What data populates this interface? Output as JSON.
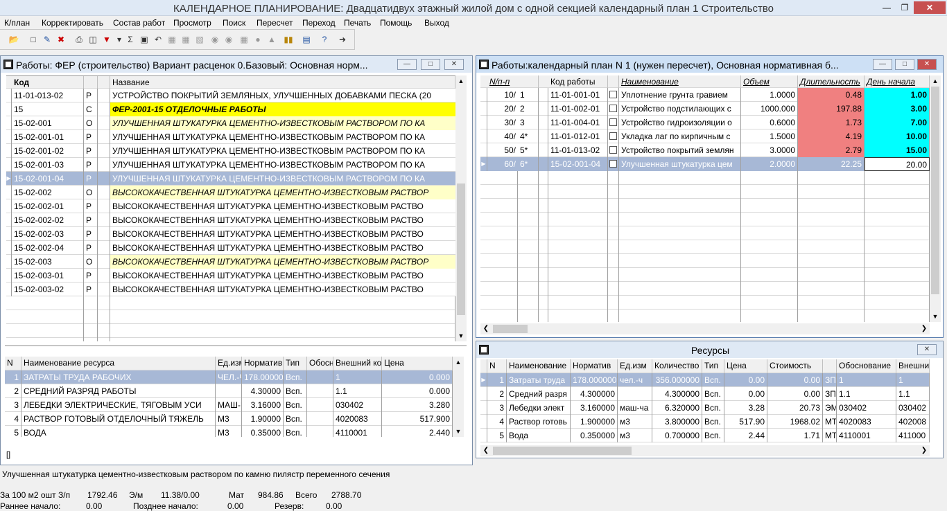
{
  "app": {
    "title": "КАЛЕНДАРНОЕ ПЛАНИРОВАНИЕ: Двадцатидвух этажный жилой дом с одной секцией календарный план 1 Строительство"
  },
  "menu": [
    "К/план",
    "Корректировать",
    "Состав работ",
    "Просмотр",
    "Поиск",
    "Пересчет",
    "Переход",
    "Печать",
    "Помощь",
    "Выход"
  ],
  "toolbar_icons": [
    "open-icon",
    "new-icon",
    "edit-icon",
    "delete-icon",
    "print-icon",
    "printer-icon",
    "copy-icon",
    "filter-icon",
    "sum-icon",
    "save-icon",
    "undo-icon",
    "grid-icon",
    "calc-icon",
    "binoculars-icon",
    "find-icon",
    "table-icon",
    "stop-icon",
    "tree-icon",
    "book-icon",
    "chart-icon",
    "help-icon",
    "exit-icon"
  ],
  "left_window": {
    "title": "Работы: ФЕР (строительство) Вариант расценок 0.Базовый: Основная норм...",
    "columns": [
      "Код",
      "",
      "",
      "Название"
    ],
    "rows": [
      {
        "code": "11-01-013-02",
        "type": "Р",
        "name": "УСТРОЙСТВО ПОКРЫТИЙ ЗЕМЛЯНЫХ, УЛУЧШЕННЫХ ДОБАВКАМИ ПЕСКА (20",
        "style": "normal"
      },
      {
        "code": "15",
        "type": "С",
        "name": "ФЕР-2001-15 ОТДЕЛОЧНЫЕ РАБОТЫ",
        "style": "section"
      },
      {
        "code": "15-02-001",
        "type": "О",
        "name": "УЛУЧШЕННАЯ ШТУКАТУРКА ЦЕМЕНТНО-ИЗВЕСТКОВЫМ РАСТВОРОМ ПО КА",
        "style": "group"
      },
      {
        "code": "15-02-001-01",
        "type": "Р",
        "name": "УЛУЧШЕННАЯ ШТУКАТУРКА ЦЕМЕНТНО-ИЗВЕСТКОВЫМ РАСТВОРОМ ПО КА",
        "style": "normal"
      },
      {
        "code": "15-02-001-02",
        "type": "Р",
        "name": "УЛУЧШЕННАЯ ШТУКАТУРКА ЦЕМЕНТНО-ИЗВЕСТКОВЫМ РАСТВОРОМ ПО КА",
        "style": "normal"
      },
      {
        "code": "15-02-001-03",
        "type": "Р",
        "name": "УЛУЧШЕННАЯ ШТУКАТУРКА ЦЕМЕНТНО-ИЗВЕСТКОВЫМ РАСТВОРОМ ПО КА",
        "style": "normal"
      },
      {
        "code": "15-02-001-04",
        "type": "Р",
        "name": "УЛУЧШЕННАЯ ШТУКАТУРКА ЦЕМЕНТНО-ИЗВЕСТКОВЫМ РАСТВОРОМ ПО КА",
        "style": "selected"
      },
      {
        "code": "15-02-002",
        "type": "О",
        "name": "ВЫСОКОКАЧЕСТВЕННАЯ ШТУКАТУРКА ЦЕМЕНТНО-ИЗВЕСТКОВЫМ РАСТВОР",
        "style": "group"
      },
      {
        "code": "15-02-002-01",
        "type": "Р",
        "name": "ВЫСОКОКАЧЕСТВЕННАЯ ШТУКАТУРКА ЦЕМЕНТНО-ИЗВЕСТКОВЫМ РАСТВО",
        "style": "normal"
      },
      {
        "code": "15-02-002-02",
        "type": "Р",
        "name": "ВЫСОКОКАЧЕСТВЕННАЯ ШТУКАТУРКА ЦЕМЕНТНО-ИЗВЕСТКОВЫМ РАСТВО",
        "style": "normal"
      },
      {
        "code": "15-02-002-03",
        "type": "Р",
        "name": "ВЫСОКОКАЧЕСТВЕННАЯ ШТУКАТУРКА ЦЕМЕНТНО-ИЗВЕСТКОВЫМ РАСТВО",
        "style": "normal"
      },
      {
        "code": "15-02-002-04",
        "type": "Р",
        "name": "ВЫСОКОКАЧЕСТВЕННАЯ ШТУКАТУРКА ЦЕМЕНТНО-ИЗВЕСТКОВЫМ РАСТВО",
        "style": "normal"
      },
      {
        "code": "15-02-003",
        "type": "О",
        "name": "ВЫСОКОКАЧЕСТВЕННАЯ ШТУКАТУРКА ЦЕМЕНТНО-ИЗВЕСТКОВЫМ РАСТВОР",
        "style": "group"
      },
      {
        "code": "15-02-003-01",
        "type": "Р",
        "name": "ВЫСОКОКАЧЕСТВЕННАЯ ШТУКАТУРКА ЦЕМЕНТНО-ИЗВЕСТКОВЫМ РАСТВО",
        "style": "normal"
      },
      {
        "code": "15-02-003-02",
        "type": "Р",
        "name": "ВЫСОКОКАЧЕСТВЕННАЯ ШТУКАТУРКА ЦЕМЕНТНО-ИЗВЕСТКОВЫМ РАСТВО",
        "style": "normal"
      }
    ],
    "res_columns": [
      "N",
      "Наименование ресурса",
      "Ед.изм",
      "Норматив",
      "Тип",
      "Обосн.",
      "Внешний ко",
      "Цена"
    ],
    "res_rows": [
      [
        "1",
        "ЗАТРАТЫ ТРУДА РАБОЧИХ",
        "ЧЕЛ.-Ч",
        "178.00000",
        "Всп.",
        "",
        "1",
        "0.000"
      ],
      [
        "2",
        "СРЕДНИЙ РАЗРЯД РАБОТЫ",
        "",
        "4.30000",
        "Всп.",
        "",
        "1.1",
        "0.000"
      ],
      [
        "3",
        "ЛЕБЕДКИ ЭЛЕКТРИЧЕСКИЕ, ТЯГОВЫМ УСИ",
        "МАШ-Ч",
        "3.16000",
        "Всп.",
        "",
        "030402",
        "3.280"
      ],
      [
        "4",
        "РАСТВОР ГОТОВЫЙ ОТДЕЛОЧНЫЙ ТЯЖЕЛЬ",
        "М3",
        "1.90000",
        "Всп.",
        "",
        "4020083",
        "517.900"
      ],
      [
        "5",
        "ВОДА",
        "М3",
        "0.35000",
        "Всп.",
        "",
        "4110001",
        "2.440"
      ]
    ]
  },
  "right_window": {
    "title": "Работы:календарный план  N 1 (нужен пересчет), Основная нормативная б...",
    "columns": [
      "N/п-п",
      "",
      "Код работы",
      "",
      "Наименование",
      "Объем",
      "Длительность",
      "День начала"
    ],
    "rows": [
      {
        "pos": "10/",
        "num": "1",
        "code": "11-01-001-01",
        "name": "Уплотнение грунта гравием",
        "volume": "1.0000",
        "duration": "0.48",
        "start": "1.00"
      },
      {
        "pos": "20/",
        "num": "2",
        "code": "11-01-002-01",
        "name": "Устройство подстилающих с",
        "volume": "1000.000",
        "duration": "197.88",
        "start": "3.00"
      },
      {
        "pos": "30/",
        "num": "3",
        "code": "11-01-004-01",
        "name": "Устройство гидроизоляции о",
        "volume": "0.6000",
        "duration": "1.73",
        "start": "7.00"
      },
      {
        "pos": "40/",
        "num": "4*",
        "code": "11-01-012-01",
        "name": "Укладка лаг по кирпичным с",
        "volume": "1.5000",
        "duration": "4.19",
        "start": "10.00"
      },
      {
        "pos": "50/",
        "num": "5*",
        "code": "11-01-013-02",
        "name": "Устройство покрытий землян",
        "volume": "3.0000",
        "duration": "2.79",
        "start": "15.00"
      },
      {
        "pos": "60/",
        "num": "6*",
        "code": "15-02-001-04",
        "name": "Улучшенная штукатурка цем",
        "volume": "2.0000",
        "duration": "22.25",
        "start": "20.00"
      }
    ]
  },
  "resources_window": {
    "title": "Ресурсы",
    "columns": [
      "N",
      "Наименование",
      "Норматив",
      "Ед.изм",
      "Количество",
      "Тип",
      "Цена",
      "Стоимость",
      "",
      "Обоснование",
      "Внешни"
    ],
    "rows": [
      [
        "1",
        "Затраты труда",
        "178.000000",
        "чел.-ч",
        "356.000000",
        "Всп.",
        "0.00",
        "0.00",
        "ЗП",
        "1",
        "1"
      ],
      [
        "2",
        "Средний разря",
        "4.300000",
        "",
        "4.300000",
        "Всп.",
        "0.00",
        "0.00",
        "ЗП",
        "1.1",
        "1.1"
      ],
      [
        "3",
        "Лебедки элект",
        "3.160000",
        "маш-ча",
        "6.320000",
        "Всп.",
        "3.28",
        "20.73",
        "ЭМ",
        "030402",
        "030402"
      ],
      [
        "4",
        "Раствор готовь",
        "1.900000",
        "м3",
        "3.800000",
        "Всп.",
        "517.90",
        "1968.02",
        "МТ",
        "4020083",
        "402008"
      ],
      [
        "5",
        "Вода",
        "0.350000",
        "м3",
        "0.700000",
        "Всп.",
        "2.44",
        "1.71",
        "МТ",
        "4110001",
        "411000"
      ]
    ]
  },
  "status": {
    "description": "Улучшенная штукатурка цементно-известковым раствором по камню пилястр переменного сечения",
    "line1": [
      {
        "label": "За 100 м2 ошт З/п",
        "value": "1792.46"
      },
      {
        "label": "Э/м",
        "value": "11.38/0.00"
      },
      {
        "label": "Мат",
        "value": "984.86"
      },
      {
        "label": "Всего",
        "value": "2788.70"
      }
    ],
    "line2": [
      {
        "label": "Раннее начало:",
        "value": "0.00"
      },
      {
        "label": "Позднее начало:",
        "value": "0.00"
      },
      {
        "label": "Резерв:",
        "value": "0.00"
      }
    ]
  },
  "colors": {
    "section": "#ffff00",
    "group": "#ffffc8",
    "selected": "#a7b8d6",
    "duration": "#f08080",
    "start": "#00ffff"
  }
}
